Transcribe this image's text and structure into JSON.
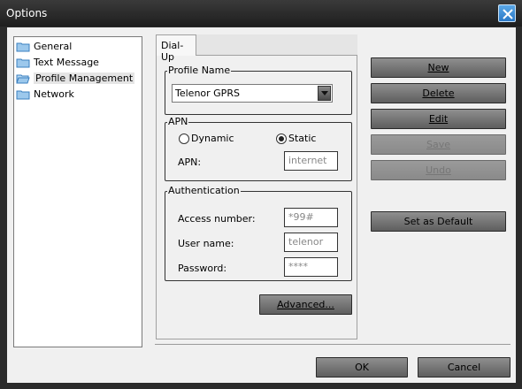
{
  "window": {
    "title": "Options"
  },
  "tree": {
    "items": [
      {
        "label": "General"
      },
      {
        "label": "Text Message"
      },
      {
        "label": "Profile Management",
        "selected": true
      },
      {
        "label": "Network"
      }
    ]
  },
  "tab": {
    "label": "Dial-Up"
  },
  "profile": {
    "group_label": "Profile Name",
    "selected_value": "Telenor GPRS"
  },
  "apn": {
    "group_label": "APN",
    "dynamic_label": "Dynamic",
    "static_label": "Static",
    "selected_mode": "Static",
    "apn_label": "APN:",
    "apn_value": "internet"
  },
  "auth": {
    "group_label": "Authentication",
    "access_label": "Access number:",
    "access_value": "*99#",
    "user_label": "User name:",
    "user_value": "telenor",
    "password_label": "Password:",
    "password_value": "****"
  },
  "buttons": {
    "advanced": "Advanced...",
    "new": "New",
    "delete": "Delete",
    "edit": "Edit",
    "save": "Save",
    "undo": "Undo",
    "set_default": "Set as Default",
    "ok": "OK",
    "cancel": "Cancel"
  },
  "colors": {
    "close_button": "#2b79c7",
    "title_bar": "#2b2b2b",
    "client": "#f0f0f0"
  }
}
